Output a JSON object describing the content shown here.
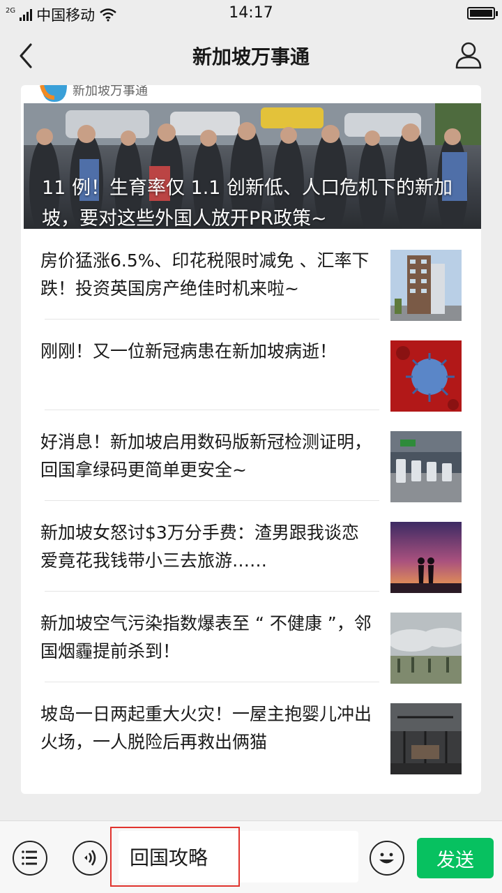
{
  "status_bar": {
    "network": "2G",
    "carrier": "中国移动",
    "time": "14:17",
    "battery_level": 1.0
  },
  "nav": {
    "title": "新加坡万事通",
    "back_icon": "chevron-left-icon",
    "profile_icon": "person-icon"
  },
  "hero": {
    "brand_name": "新加坡万事通",
    "title": "11 例！生育率仅 1.1 创新低、人口危机下的新加坡，要对这些外国人放开PR政策~"
  },
  "articles": [
    {
      "title": "房价猛涨6.5%、印花税限时减免 、汇率下跌！投资英国房产绝佳时机来啦~",
      "thumb": "building"
    },
    {
      "title": "刚刚！又一位新冠病患在新加坡病逝！",
      "thumb": "virus"
    },
    {
      "title": "好消息！新加坡启用数码版新冠检测证明，回国拿绿码更简单更安全~",
      "thumb": "airport"
    },
    {
      "title": "新加坡女怒讨$3万分手费：渣男跟我谈恋爱竟花我钱带小三去旅游……",
      "thumb": "sunset-couple"
    },
    {
      "title": "新加坡空气污染指数爆表至 “ 不健康 ”，邻国烟霾提前杀到！",
      "thumb": "haze"
    },
    {
      "title": "坡岛一日两起重大火灾！一屋主抱婴儿冲出火场，一人脱险后再救出俩猫",
      "thumb": "fire"
    }
  ],
  "bottom_bar": {
    "input_value": "回国攻略",
    "send_label": "发送",
    "menu_icon": "list-icon",
    "voice_icon": "voice-icon",
    "emoji_icon": "emoji-icon"
  },
  "colors": {
    "send_button": "#07c160",
    "background": "#ededed",
    "highlight": "#e0332d"
  }
}
